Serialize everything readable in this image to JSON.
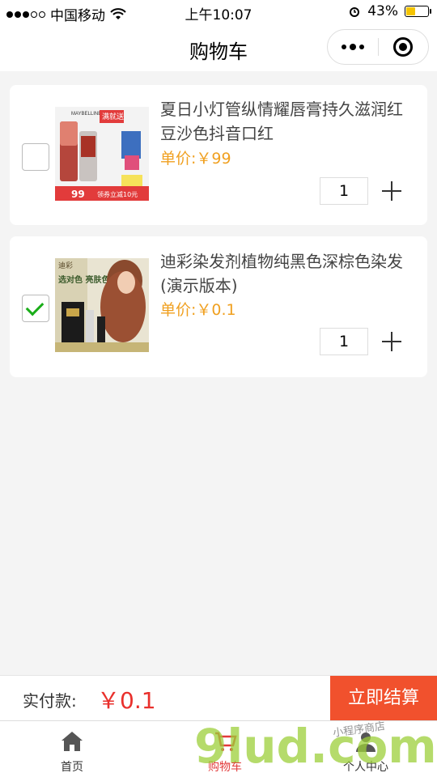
{
  "status_bar": {
    "carrier": "中国移动",
    "time": "上午10:07",
    "battery": "43%",
    "battery_level": 0.43
  },
  "nav": {
    "title": "购物车"
  },
  "cart": {
    "items": [
      {
        "title": "夏日小灯管纵情耀唇膏持久滋润红豆沙色抖音口红",
        "price": "单价:￥99",
        "quantity": "1",
        "checked": false,
        "image": {
          "brand": "MAYBELLINE",
          "promo_text": "满就送",
          "price_tag": "99",
          "coupon": "领券立减10元"
        }
      },
      {
        "title": "迪彩染发剂植物纯黑色深棕色染发(演示版本)",
        "price": "单价:￥0.1",
        "quantity": "1",
        "checked": true,
        "image": {
          "brand": "迪彩",
          "slogan": "选对色 亮肤色"
        }
      }
    ]
  },
  "checkout": {
    "label": "实付款:",
    "amount": "￥0.1",
    "button": "立即结算"
  },
  "tab_bar": {
    "tabs": [
      {
        "label": "首页",
        "icon": "home-icon"
      },
      {
        "label": "购物车",
        "icon": "cart-icon"
      },
      {
        "label": "个人中心",
        "icon": "user-icon"
      }
    ]
  },
  "watermark": {
    "text": "9lud.com",
    "sub_text": "小程序商店"
  },
  "colors": {
    "accent": "#f1512d",
    "price": "#f0a020",
    "amount": "#e9302c",
    "check": "#1aad19"
  }
}
